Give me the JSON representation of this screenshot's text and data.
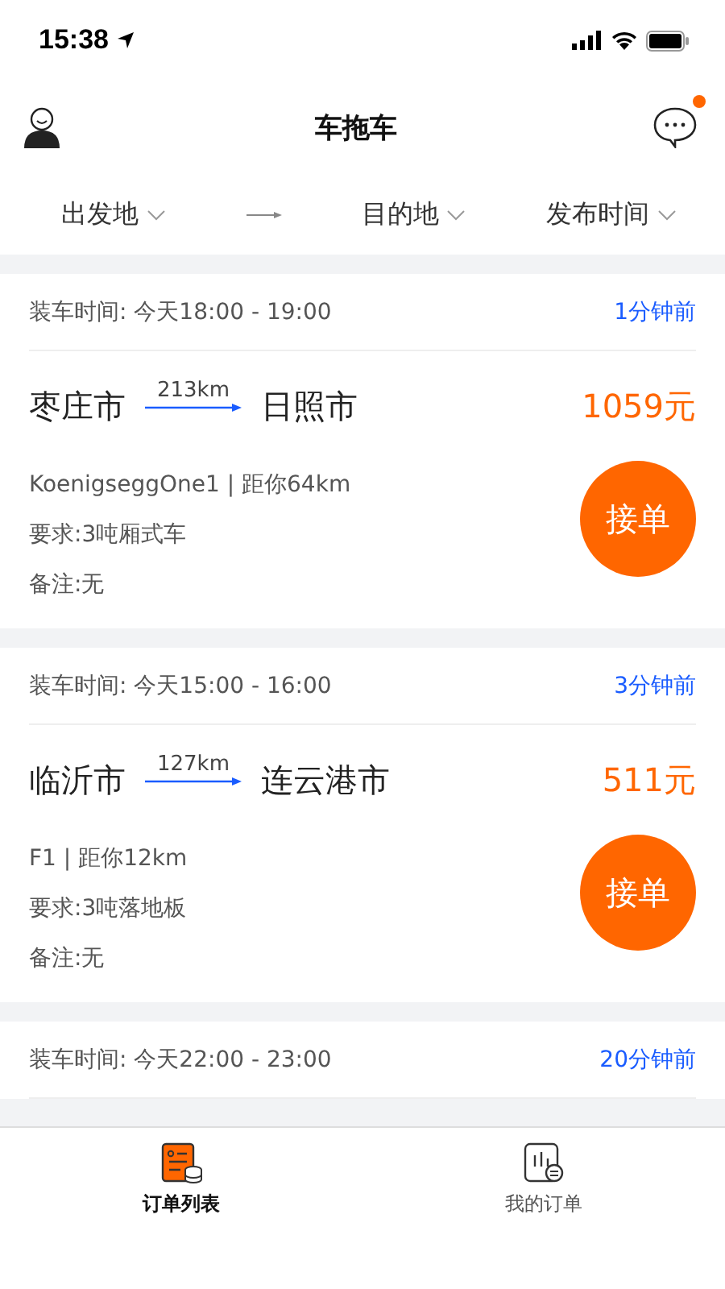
{
  "status_bar": {
    "time": "15:38"
  },
  "header": {
    "title": "车拖车",
    "has_notification": true
  },
  "filters": [
    {
      "label": "出发地"
    },
    {
      "label": "目的地"
    },
    {
      "label": "发布时间"
    }
  ],
  "orders": [
    {
      "load_time": "装车时间: 今天18:00 - 19:00",
      "posted": "1分钟前",
      "from": "枣庄市",
      "distance": "213km",
      "to": "日照市",
      "price": "1059元",
      "vehicle_info": "KoenigseggOne1 | 距你64km",
      "requirement": "要求:3吨厢式车",
      "note": "备注:无",
      "action": "接单"
    },
    {
      "load_time": "装车时间: 今天15:00 - 16:00",
      "posted": "3分钟前",
      "from": "临沂市",
      "distance": "127km",
      "to": "连云港市",
      "price": "511元",
      "vehicle_info": "F1 | 距你12km",
      "requirement": "要求:3吨落地板",
      "note": "备注:无",
      "action": "接单"
    },
    {
      "load_time": "装车时间: 今天22:00 - 23:00",
      "posted": "20分钟前"
    }
  ],
  "tabs": [
    {
      "label": "订单列表",
      "selected": true
    },
    {
      "label": "我的订单",
      "selected": false
    }
  ]
}
